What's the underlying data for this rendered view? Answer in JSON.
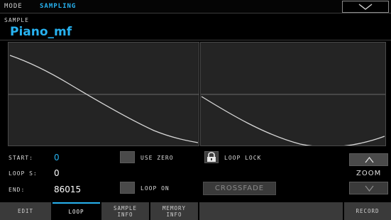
{
  "mode": {
    "label": "MODE",
    "value": "SAMPLING"
  },
  "sample": {
    "label": "SAMPLE",
    "name": "Piano_mf"
  },
  "params": {
    "start_label": "START:",
    "start_value": "0",
    "loop_s_label": "LOOP S:",
    "loop_s_value": "0",
    "end_label": "END:",
    "end_value": "86015"
  },
  "options": {
    "use_zero": "USE ZERO",
    "loop_lock": "LOOP LOCK",
    "loop_on": "LOOP ON",
    "crossfade": "CROSSFADE"
  },
  "zoom": {
    "label": "ZOOM"
  },
  "tabs": [
    {
      "line1": "EDIT",
      "line2": ""
    },
    {
      "line1": "LOOP",
      "line2": ""
    },
    {
      "line1": "SAMPLE",
      "line2": "INFO"
    },
    {
      "line1": "MEMORY",
      "line2": "INFO"
    },
    {
      "line1": "RECORD",
      "line2": ""
    }
  ],
  "colors": {
    "accent": "#27b2f0",
    "value_white": "#ffffff",
    "panel": "#242424",
    "button": "#4a4a4a"
  },
  "icons": [
    "chevron-down-icon",
    "lock-icon",
    "chevron-up-icon"
  ]
}
